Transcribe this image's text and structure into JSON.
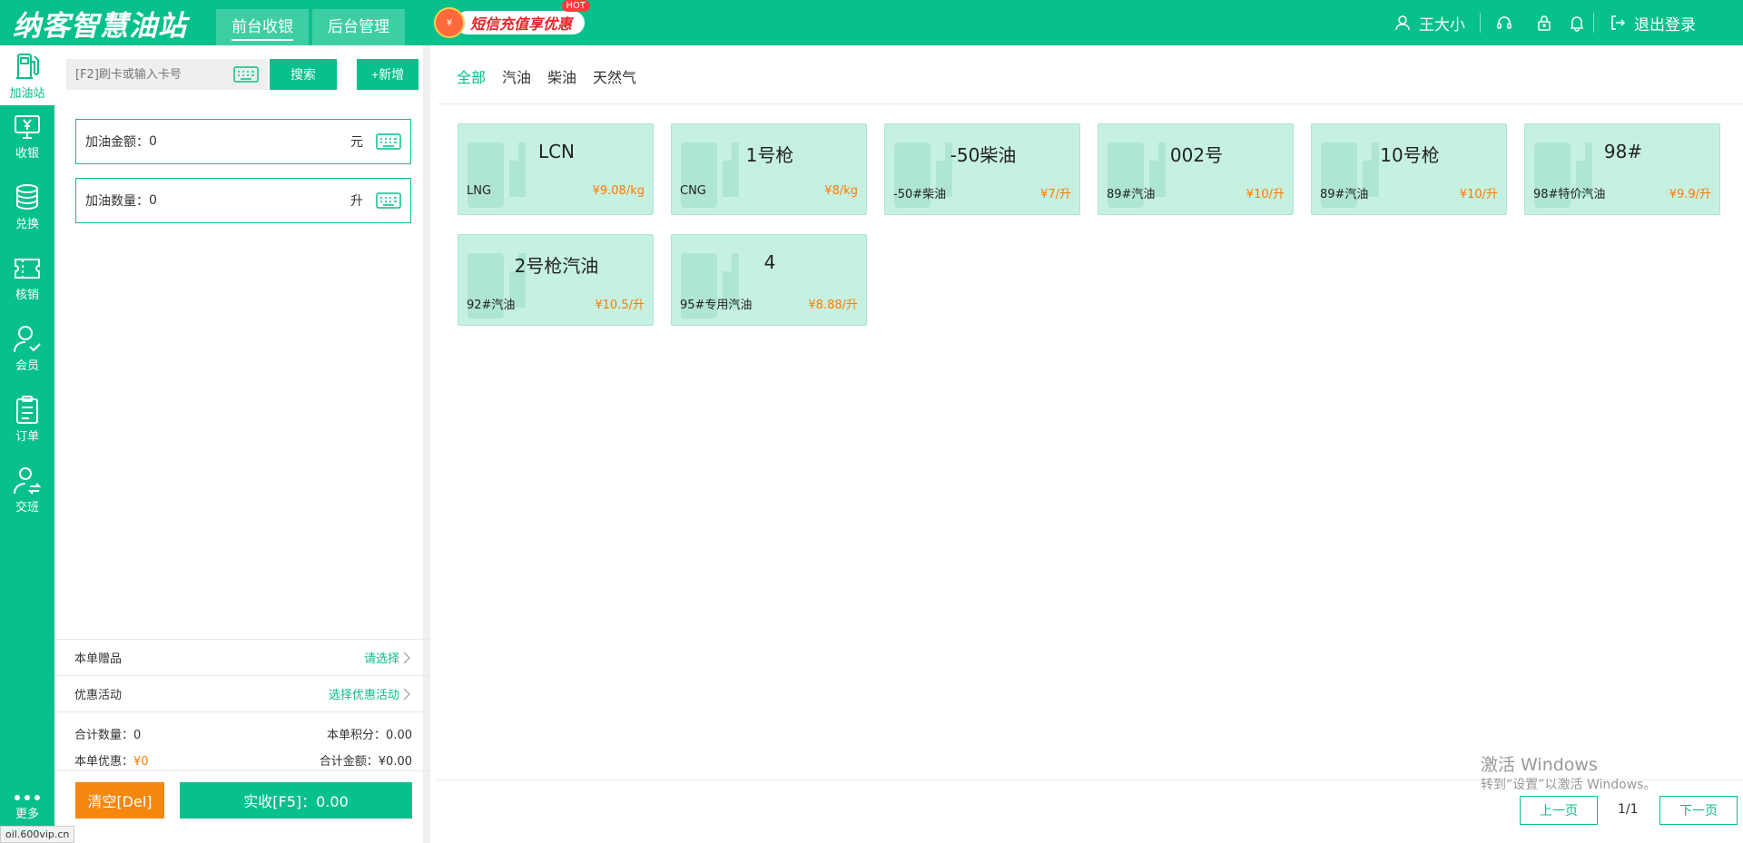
{
  "app": {
    "logo": "纳客智慧油站",
    "tabs": [
      {
        "label": "前台收银"
      },
      {
        "label": "后台管理"
      }
    ],
    "promo": {
      "label": "短信充值享优惠",
      "badge": "HOT",
      "bag_text": "¥"
    }
  },
  "header": {
    "user_name": "王大小",
    "logout": "退出登录"
  },
  "sidebar": {
    "items": [
      {
        "label": "加油站"
      },
      {
        "label": "收银"
      },
      {
        "label": "兑换"
      },
      {
        "label": "核销"
      },
      {
        "label": "会员"
      },
      {
        "label": "订单"
      },
      {
        "label": "交班"
      }
    ],
    "more": "更多"
  },
  "left": {
    "search_placeholder": "[F2]刷卡或输入卡号",
    "search_btn": "搜索",
    "add_btn": "+新增",
    "amount_label": "加油金额：",
    "amount_value": "0",
    "amount_unit": "元",
    "qty_label": "加油数量：",
    "qty_value": "0",
    "qty_unit": "升",
    "gift_label": "本单赠品",
    "gift_link": "请选择",
    "promo_label": "优惠活动",
    "promo_link": "选择优惠活动",
    "total_qty_label": "合计数量：",
    "total_qty": "0",
    "points_label": "本单积分：",
    "points": "0.00",
    "discount_label": "本单优惠：",
    "discount": "¥0",
    "total_amount_label": "合计金额：",
    "total_amount": "¥0.00",
    "clear_btn": "清空[Del]",
    "pay_btn": "实收[F5]：0.00"
  },
  "filters": [
    {
      "label": "全部"
    },
    {
      "label": "汽油"
    },
    {
      "label": "柴油"
    },
    {
      "label": "天然气"
    }
  ],
  "nozzles": [
    {
      "name": "LCN",
      "type": "LNG",
      "price": "¥9.08/kg"
    },
    {
      "name": "1号枪",
      "type": "CNG",
      "price": "¥8/kg"
    },
    {
      "name": "-50柴油",
      "type": "-50#柴油",
      "price": "¥7/升"
    },
    {
      "name": "002号",
      "type": "89#汽油",
      "price": "¥10/升"
    },
    {
      "name": "10号枪",
      "type": "89#汽油",
      "price": "¥10/升"
    },
    {
      "name": "98#",
      "type": "98#特价汽油",
      "price": "¥9.9/升"
    },
    {
      "name": "2号枪汽油",
      "type": "92#汽油",
      "price": "¥10.5/升"
    },
    {
      "name": "4",
      "type": "95#专用汽油",
      "price": "¥8.88/升"
    }
  ],
  "pager": {
    "prev": "上一页",
    "page": "1/1",
    "next": "下一页"
  },
  "os_watermark": {
    "line1": "激活 Windows",
    "line2": "转到“设置”以激活 Windows。"
  },
  "status_url": "oil.600vip.cn"
}
